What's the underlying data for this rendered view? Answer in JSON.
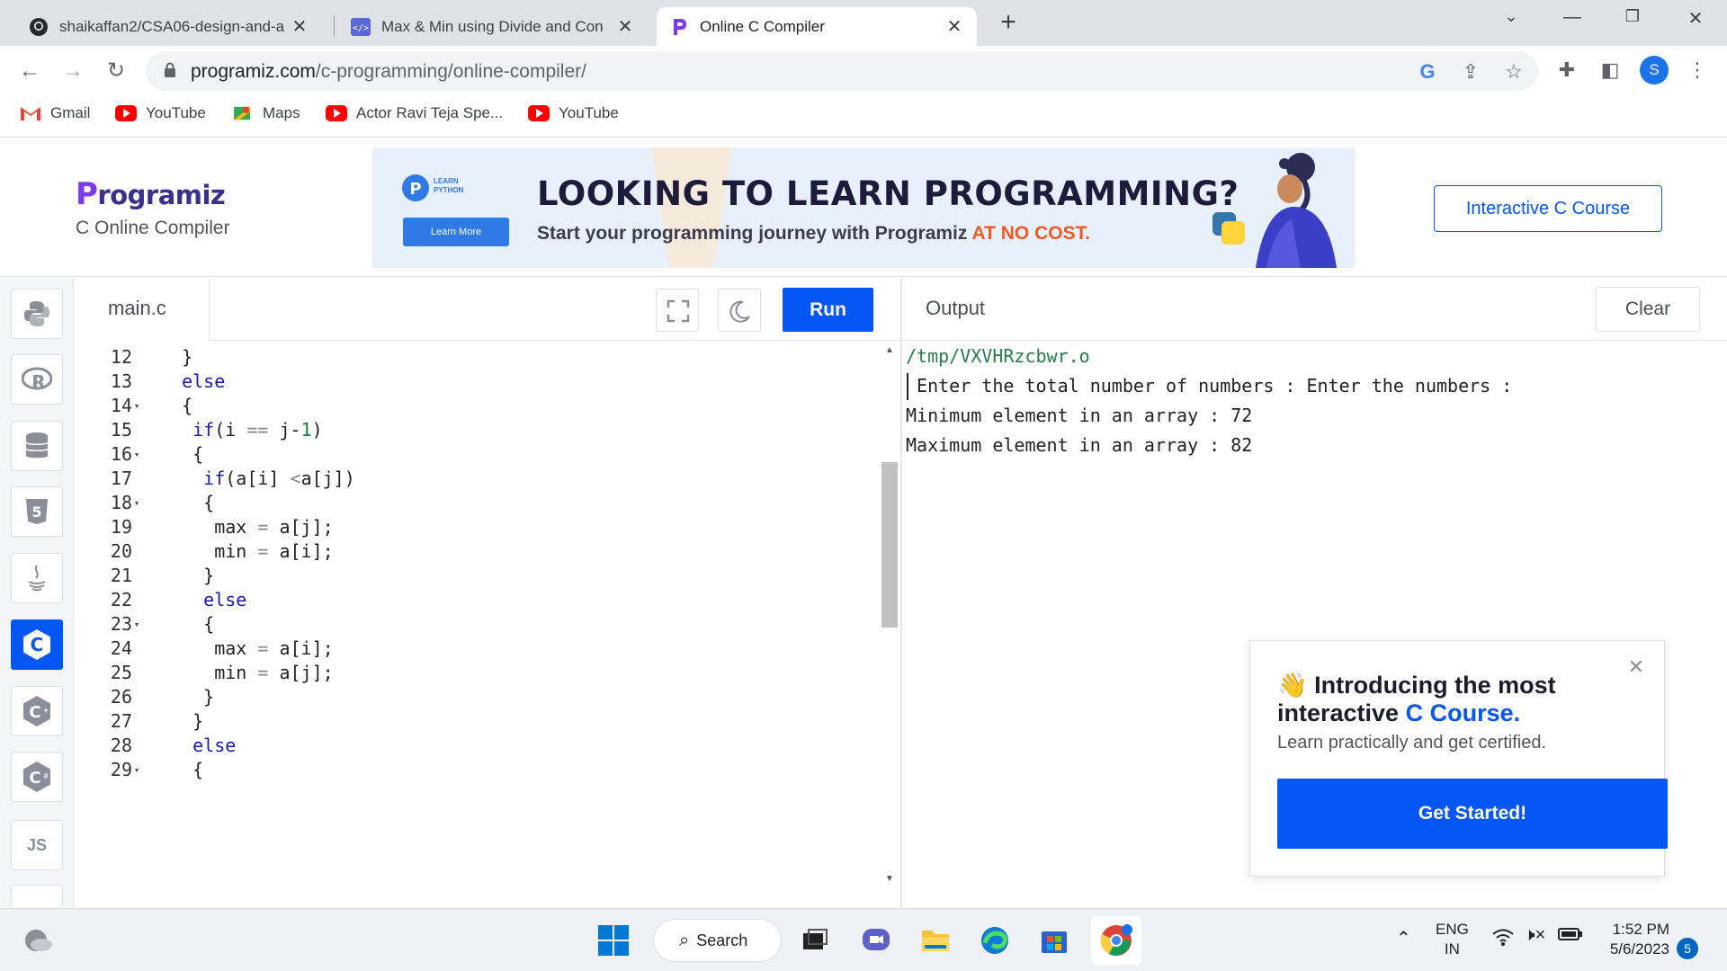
{
  "browser": {
    "tabs": [
      {
        "title": "shaikaffan2/CSA06-design-and-a",
        "icon": "github-icon"
      },
      {
        "title": "Max & Min using Divide and Con",
        "icon": "code-icon"
      },
      {
        "title": "Online C Compiler",
        "icon": "programiz-icon"
      }
    ],
    "url_host": "programiz.com",
    "url_path": "/c-programming/online-compiler/",
    "profile_initial": "S",
    "bookmarks": [
      {
        "label": "Gmail",
        "icon": "gmail-icon"
      },
      {
        "label": "YouTube",
        "icon": "youtube-icon"
      },
      {
        "label": "Maps",
        "icon": "maps-icon"
      },
      {
        "label": "Actor Ravi Teja Spe...",
        "icon": "youtube-icon"
      },
      {
        "label": "YouTube",
        "icon": "youtube-icon"
      }
    ]
  },
  "header": {
    "logo": "rogramiz",
    "logo_initial": "P",
    "subtitle": "C Online Compiler",
    "ad": {
      "badge_line1": "LEARN",
      "badge_line2": "PYTHON",
      "learn_more": "Learn More",
      "headline": "LOOKING TO LEARN PROGRAMMING?",
      "sub": "Start your programming journey with Programiz",
      "sub_highlight": "AT NO COST."
    },
    "interactive_button": "Interactive C Course"
  },
  "sidebar": {
    "languages": [
      "python",
      "r",
      "sql",
      "html",
      "java",
      "c",
      "c++",
      "c#",
      "JS"
    ],
    "active": "c",
    "js_label": "JS"
  },
  "editor": {
    "file_name": "main.c",
    "run_label": "Run",
    "lines": [
      {
        "n": "12",
        "fold": "",
        "code": "  }"
      },
      {
        "n": "13",
        "fold": "",
        "code": "  else"
      },
      {
        "n": "14",
        "fold": "▾",
        "code": "  {"
      },
      {
        "n": "15",
        "fold": "",
        "code": "   if(i == j-1)"
      },
      {
        "n": "16",
        "fold": "▾",
        "code": "   {"
      },
      {
        "n": "17",
        "fold": "",
        "code": "    if(a[i] <a[j])"
      },
      {
        "n": "18",
        "fold": "▾",
        "code": "    {"
      },
      {
        "n": "19",
        "fold": "",
        "code": "     max = a[j];"
      },
      {
        "n": "20",
        "fold": "",
        "code": "     min = a[i];"
      },
      {
        "n": "21",
        "fold": "",
        "code": "    }"
      },
      {
        "n": "22",
        "fold": "",
        "code": "    else"
      },
      {
        "n": "23",
        "fold": "▾",
        "code": "    {"
      },
      {
        "n": "24",
        "fold": "",
        "code": "     max = a[i];"
      },
      {
        "n": "25",
        "fold": "",
        "code": "     min = a[j];"
      },
      {
        "n": "26",
        "fold": "",
        "code": "    }"
      },
      {
        "n": "27",
        "fold": "",
        "code": "   }"
      },
      {
        "n": "28",
        "fold": "",
        "code": "   else"
      },
      {
        "n": "29",
        "fold": "▾",
        "code": "   {"
      }
    ]
  },
  "output": {
    "title": "Output",
    "clear_label": "Clear",
    "lines": [
      "/tmp/VXVHRzcbwr.o",
      " Enter the total number of numbers : Enter the numbers :",
      "Minimum element in an array : 72",
      "Maximum element in an array : 82"
    ]
  },
  "promo": {
    "emoji": "👋",
    "title_pre": "Introducing the most interactive",
    "title_accent": "C Course.",
    "desc": "Learn practically and get certified.",
    "button": "Get Started!"
  },
  "taskbar": {
    "search_label": "Search",
    "lang_line1": "ENG",
    "lang_line2": "IN",
    "time": "1:52 PM",
    "date": "5/6/2023",
    "notifications": "5"
  }
}
